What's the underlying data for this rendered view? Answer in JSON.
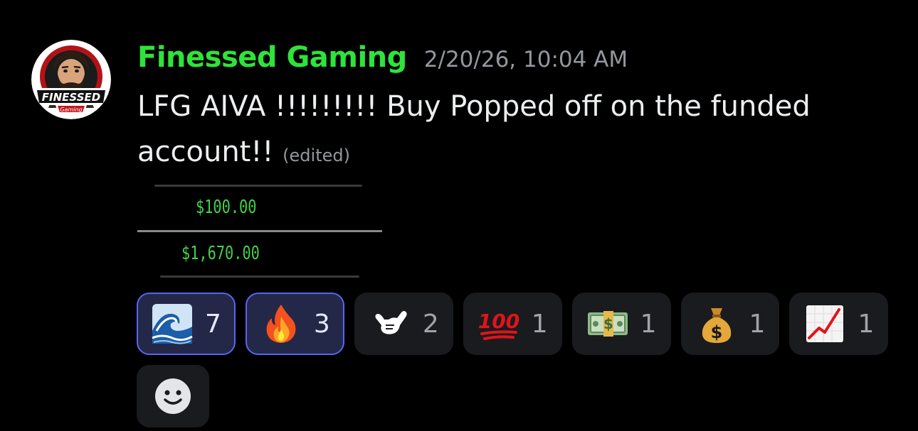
{
  "message": {
    "author": "Finessed Gaming",
    "timestamp": "2/20/26, 10:04 AM",
    "text": "LFG AIVA !!!!!!!!! Buy Popped off on the funded account!!",
    "edited_label": "(edited)",
    "author_color": "#2ee33a",
    "avatar": {
      "icon": "finessed-gaming-logo",
      "logo_text": "FINESSED",
      "logo_subtext": "Gaming"
    }
  },
  "attachment": {
    "amount_top": "$100.00",
    "amount_bottom": "$1,670.00",
    "amount_color": "#43d14a"
  },
  "reactions": [
    {
      "icon": "water-wave-emoji",
      "count": "7",
      "active": true
    },
    {
      "icon": "fire-emoji",
      "count": "3",
      "active": true
    },
    {
      "icon": "shaka-hand-emoji",
      "count": "2",
      "active": false
    },
    {
      "icon": "hundred-points-emoji",
      "count": "1",
      "active": false
    },
    {
      "icon": "dollar-banknote-emoji",
      "count": "1",
      "active": false
    },
    {
      "icon": "money-bag-emoji",
      "count": "1",
      "active": false
    },
    {
      "icon": "chart-increasing-emoji",
      "count": "1",
      "active": false
    }
  ],
  "add_reaction": {
    "icon": "add-reaction-smiley-icon"
  },
  "colors": {
    "background": "#000000",
    "accent": "#5865f2",
    "muted_text": "#94979d"
  }
}
